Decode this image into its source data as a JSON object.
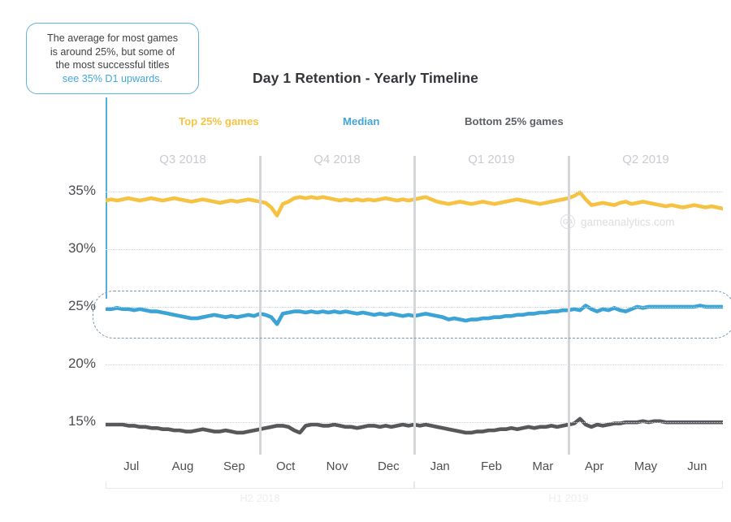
{
  "callout": {
    "line1": "The average for most games",
    "line2": "is around 25%, but some of",
    "line3": "the most successful titles",
    "highlight": "see 35% D1 upwards."
  },
  "watermark": {
    "logo_text": "GA",
    "text": "gameanalytics.com"
  },
  "chart_data": {
    "type": "line",
    "title": "Day 1 Retention - Yearly Timeline",
    "xlabel": "",
    "ylabel": "",
    "ylim": [
      12.2,
      36.8
    ],
    "grid": true,
    "legend_position": "top",
    "y_ticks": [
      35,
      30,
      25,
      20,
      15
    ],
    "y_tick_labels": [
      "35%",
      "30%",
      "25%",
      "20%",
      "15%"
    ],
    "categories": [
      "Jul",
      "Aug",
      "Sep",
      "Oct",
      "Nov",
      "Dec",
      "Jan",
      "Feb",
      "Mar",
      "Apr",
      "May",
      "Jun"
    ],
    "quarter_labels": [
      "Q3 2018",
      "Q4 2018",
      "Q1 2019",
      "Q2 2019"
    ],
    "half_labels": [
      "H2 2018",
      "H1 2019"
    ],
    "series": [
      {
        "name": "Top 25% games",
        "color": "#f5c242",
        "values": [
          34.2,
          34.3,
          34.2,
          34.3,
          34.4,
          34.3,
          34.2,
          34.3,
          34.4,
          34.3,
          34.2,
          34.3,
          34.4,
          34.3,
          34.2,
          34.1,
          34.2,
          34.3,
          34.2,
          34.1,
          34.0,
          34.1,
          34.2,
          34.1,
          34.2,
          34.3,
          34.2,
          34.1,
          34.0,
          33.6,
          32.9,
          33.9,
          34.1,
          34.4,
          34.5,
          34.4,
          34.5,
          34.4,
          34.5,
          34.4,
          34.3,
          34.2,
          34.3,
          34.2,
          34.3,
          34.2,
          34.3,
          34.2,
          34.3,
          34.4,
          34.3,
          34.2,
          34.3,
          34.2,
          34.3,
          34.4,
          34.5,
          34.3,
          34.1,
          34.0,
          33.9,
          34.0,
          34.1,
          34.0,
          33.9,
          34.0,
          34.1,
          34.0,
          33.9,
          34.0,
          34.1,
          34.2,
          34.3,
          34.2,
          34.1,
          34.0,
          33.9,
          34.0,
          34.1,
          34.2,
          34.3,
          34.4,
          34.6,
          34.9,
          34.3,
          33.8,
          33.9,
          34.0,
          33.9,
          33.8,
          34.0,
          34.1,
          33.9,
          34.0,
          34.1,
          34.0,
          33.9,
          33.8,
          33.7,
          33.8,
          33.7,
          33.6,
          33.7,
          33.8,
          33.7,
          33.6,
          33.7,
          33.6,
          33.5
        ]
      },
      {
        "name": "Median",
        "color": "#3ba3d6",
        "values": [
          24.8,
          24.8,
          24.9,
          24.8,
          24.8,
          24.7,
          24.8,
          24.7,
          24.6,
          24.6,
          24.5,
          24.4,
          24.3,
          24.2,
          24.1,
          24.0,
          24.0,
          24.1,
          24.2,
          24.3,
          24.2,
          24.1,
          24.2,
          24.1,
          24.2,
          24.3,
          24.2,
          24.4,
          24.3,
          24.1,
          23.5,
          24.4,
          24.5,
          24.6,
          24.6,
          24.5,
          24.6,
          24.5,
          24.6,
          24.5,
          24.6,
          24.5,
          24.6,
          24.5,
          24.4,
          24.5,
          24.4,
          24.3,
          24.4,
          24.3,
          24.4,
          24.3,
          24.2,
          24.3,
          24.2,
          24.3,
          24.4,
          24.3,
          24.2,
          24.1,
          23.9,
          24.0,
          23.9,
          23.8,
          23.9,
          23.9,
          24.0,
          24.0,
          24.1,
          24.1,
          24.2,
          24.2,
          24.3,
          24.3,
          24.4,
          24.4,
          24.5,
          24.5,
          24.6,
          24.6,
          24.7,
          24.7,
          24.8,
          24.7,
          25.1,
          24.8,
          24.6,
          24.8,
          24.7,
          24.9,
          24.7,
          24.6,
          24.8,
          25.0,
          24.9,
          25.0,
          25.0,
          25.0,
          25.0,
          25.0,
          25.0,
          25.0,
          25.0,
          25.0,
          25.1,
          25.0,
          25.0,
          25.0,
          25.0
        ]
      },
      {
        "name": "Bottom 25% games",
        "color": "#58585a",
        "values": [
          14.8,
          14.8,
          14.8,
          14.8,
          14.7,
          14.7,
          14.6,
          14.6,
          14.5,
          14.5,
          14.4,
          14.4,
          14.3,
          14.3,
          14.2,
          14.2,
          14.3,
          14.4,
          14.3,
          14.2,
          14.2,
          14.3,
          14.2,
          14.1,
          14.1,
          14.2,
          14.3,
          14.4,
          14.5,
          14.6,
          14.7,
          14.7,
          14.6,
          14.3,
          14.1,
          14.7,
          14.8,
          14.8,
          14.7,
          14.7,
          14.8,
          14.7,
          14.6,
          14.6,
          14.5,
          14.6,
          14.7,
          14.7,
          14.6,
          14.7,
          14.6,
          14.7,
          14.8,
          14.7,
          14.8,
          14.7,
          14.8,
          14.7,
          14.6,
          14.5,
          14.4,
          14.3,
          14.2,
          14.1,
          14.1,
          14.2,
          14.2,
          14.3,
          14.3,
          14.4,
          14.4,
          14.5,
          14.4,
          14.5,
          14.6,
          14.5,
          14.6,
          14.6,
          14.7,
          14.6,
          14.7,
          14.8,
          14.9,
          15.3,
          14.8,
          14.6,
          14.8,
          14.7,
          14.8,
          14.9,
          14.9,
          15.0,
          15.0,
          15.0,
          15.1,
          15.0,
          15.1,
          15.1,
          15.0,
          15.0,
          15.0,
          15.0,
          15.0,
          15.0,
          15.0,
          15.0,
          15.0,
          15.0,
          15.0
        ]
      }
    ]
  }
}
